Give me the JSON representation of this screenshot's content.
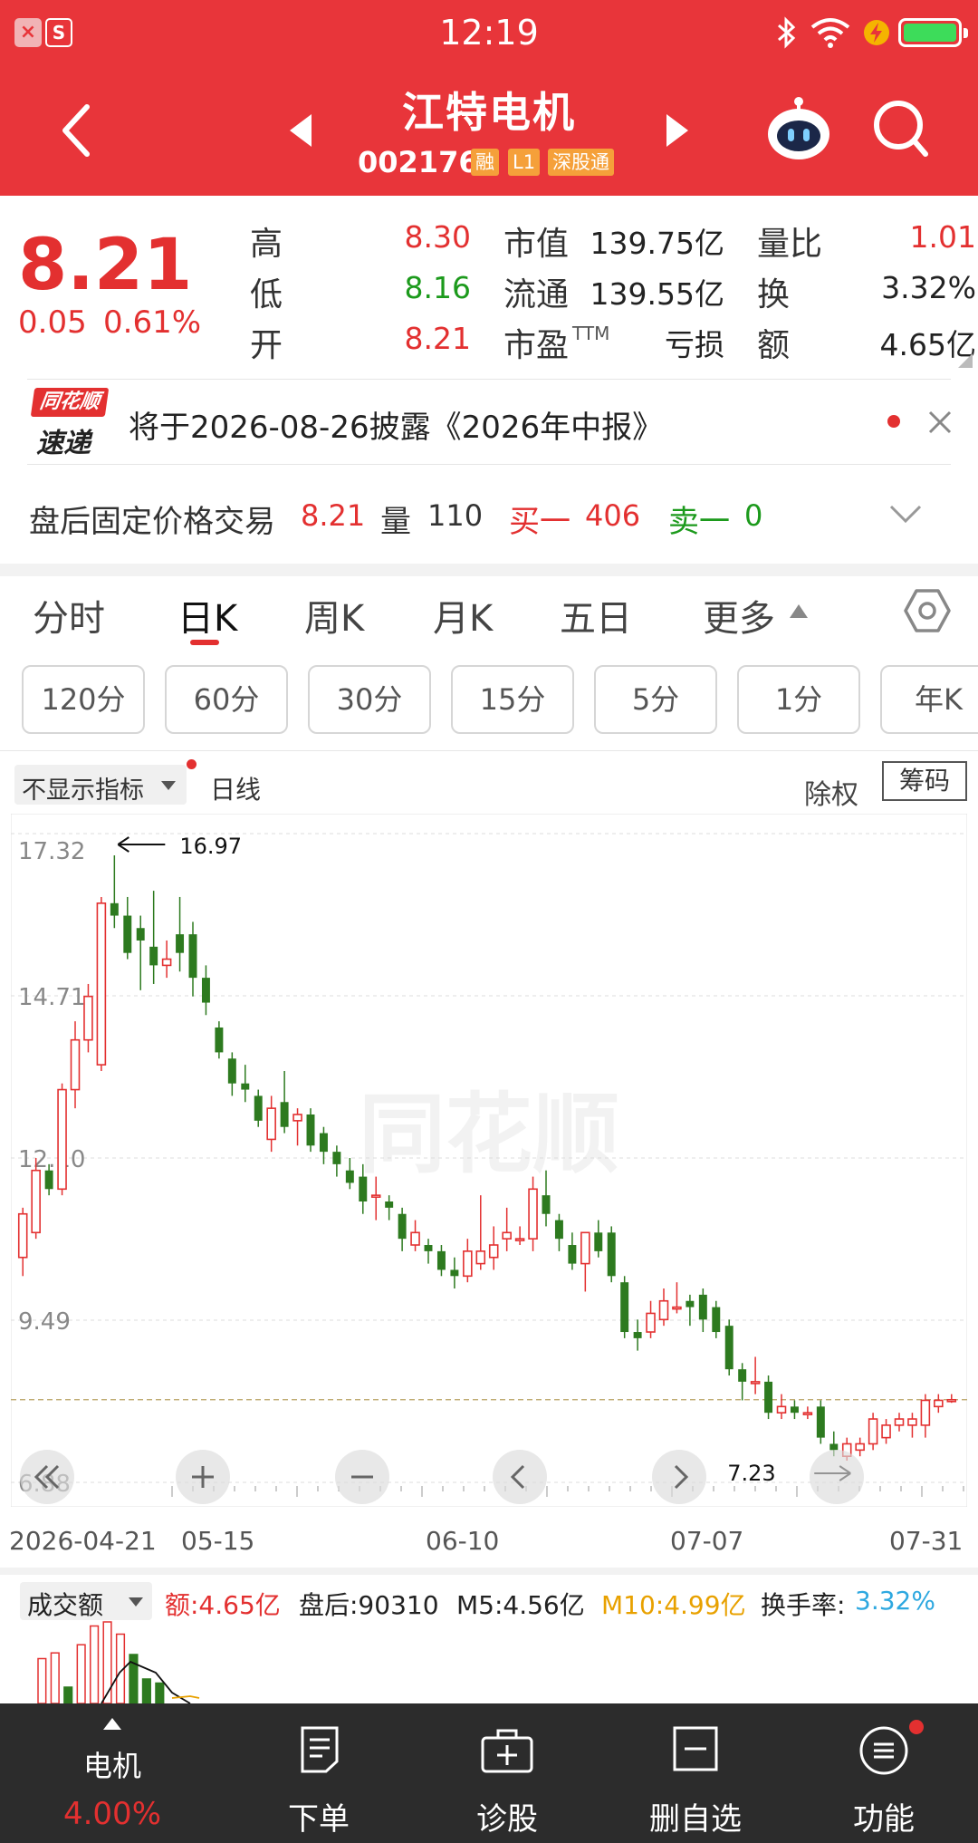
{
  "status_bar": {
    "time": "12:19"
  },
  "header": {
    "title": "江特电机",
    "code": "002176",
    "tags": [
      "融",
      "L1",
      "深股通"
    ]
  },
  "quote": {
    "price": "8.21",
    "change": "0.05",
    "change_pct": "0.61%",
    "fields": {
      "high_label": "高",
      "high": "8.30",
      "low_label": "低",
      "low": "8.16",
      "open_label": "开",
      "open": "8.21",
      "mcap_label": "市值",
      "mcap": "139.75亿",
      "float_label": "流通",
      "float": "139.55亿",
      "pe_label": "市盈",
      "pe_sup": "TTM",
      "pe": "亏损",
      "vr_label": "量比",
      "vr": "1.01",
      "turnover_label": "换",
      "turnover": "3.32%",
      "amount_label": "额",
      "amount": "4.65亿"
    }
  },
  "news": {
    "logo_top": "同花顺",
    "logo_bottom": "速递",
    "text": "将于2026-08-26披露《2026年中报》"
  },
  "after_hours": {
    "label": "盘后固定价格交易",
    "price": "8.21",
    "vol_label": "量",
    "vol": "110",
    "buy_label": "买一",
    "buy": "406",
    "sell_label": "卖一",
    "sell": "0"
  },
  "tabs": [
    "分时",
    "日K",
    "周K",
    "月K",
    "五日",
    "更多"
  ],
  "active_tab": "日K",
  "intervals": [
    "120分",
    "60分",
    "30分",
    "15分",
    "5分",
    "1分",
    "年K"
  ],
  "chart_header": {
    "indicator": "不显示指标",
    "line_type": "日线",
    "adjust": "除权",
    "chips": "筹码"
  },
  "chart_data": {
    "type": "candlestick",
    "y_ticks": [
      "17.32",
      "14.71",
      "12.10",
      "9.49",
      "6.88"
    ],
    "ylim": [
      6.88,
      17.32
    ],
    "x_ticks": [
      "2026-04-21",
      "05-15",
      "06-10",
      "07-07",
      "07-31"
    ],
    "high_annotation": "16.97",
    "low_annotation": "7.23",
    "watermark": "同花顺",
    "reference_price": 8.21,
    "candles": [
      {
        "o": 10.5,
        "c": 11.2,
        "h": 11.3,
        "l": 10.2
      },
      {
        "o": 10.9,
        "c": 11.9,
        "h": 12.1,
        "l": 10.8
      },
      {
        "o": 11.9,
        "c": 11.6,
        "h": 12.0,
        "l": 11.5
      },
      {
        "o": 11.6,
        "c": 13.2,
        "h": 13.3,
        "l": 11.5
      },
      {
        "o": 13.2,
        "c": 14.0,
        "h": 14.3,
        "l": 12.9
      },
      {
        "o": 14.0,
        "c": 14.7,
        "h": 14.9,
        "l": 13.8
      },
      {
        "o": 13.6,
        "c": 16.2,
        "h": 16.3,
        "l": 13.5
      },
      {
        "o": 16.2,
        "c": 16.0,
        "h": 16.97,
        "l": 15.8
      },
      {
        "o": 16.0,
        "c": 15.4,
        "h": 16.3,
        "l": 15.3
      },
      {
        "o": 15.8,
        "c": 15.6,
        "h": 16.0,
        "l": 14.8
      },
      {
        "o": 15.5,
        "c": 15.2,
        "h": 16.4,
        "l": 14.9
      },
      {
        "o": 15.2,
        "c": 15.3,
        "h": 15.6,
        "l": 15.0
      },
      {
        "o": 15.7,
        "c": 15.4,
        "h": 16.3,
        "l": 15.1
      },
      {
        "o": 15.7,
        "c": 15.0,
        "h": 15.9,
        "l": 14.7
      },
      {
        "o": 15.0,
        "c": 14.6,
        "h": 15.2,
        "l": 14.4
      },
      {
        "o": 14.2,
        "c": 13.8,
        "h": 14.3,
        "l": 13.7
      },
      {
        "o": 13.7,
        "c": 13.3,
        "h": 13.8,
        "l": 13.1
      },
      {
        "o": 13.3,
        "c": 13.2,
        "h": 13.6,
        "l": 13.0
      },
      {
        "o": 13.1,
        "c": 12.7,
        "h": 13.2,
        "l": 12.6
      },
      {
        "o": 12.4,
        "c": 12.9,
        "h": 13.1,
        "l": 12.2
      },
      {
        "o": 13.0,
        "c": 12.6,
        "h": 13.5,
        "l": 12.5
      },
      {
        "o": 12.7,
        "c": 12.8,
        "h": 12.9,
        "l": 12.3
      },
      {
        "o": 12.8,
        "c": 12.3,
        "h": 12.9,
        "l": 12.2
      },
      {
        "o": 12.5,
        "c": 12.2,
        "h": 12.6,
        "l": 12.0
      },
      {
        "o": 12.2,
        "c": 12.0,
        "h": 12.3,
        "l": 11.8
      },
      {
        "o": 11.9,
        "c": 11.7,
        "h": 12.1,
        "l": 11.6
      },
      {
        "o": 11.8,
        "c": 11.4,
        "h": 12.0,
        "l": 11.2
      },
      {
        "o": 11.5,
        "c": 11.5,
        "h": 11.8,
        "l": 11.1
      },
      {
        "o": 11.4,
        "c": 11.3,
        "h": 11.5,
        "l": 11.1
      },
      {
        "o": 11.2,
        "c": 10.8,
        "h": 11.3,
        "l": 10.6
      },
      {
        "o": 10.7,
        "c": 10.9,
        "h": 11.1,
        "l": 10.6
      },
      {
        "o": 10.7,
        "c": 10.6,
        "h": 10.8,
        "l": 10.4
      },
      {
        "o": 10.6,
        "c": 10.3,
        "h": 10.7,
        "l": 10.2
      },
      {
        "o": 10.3,
        "c": 10.2,
        "h": 10.5,
        "l": 10.0
      },
      {
        "o": 10.2,
        "c": 10.6,
        "h": 10.8,
        "l": 10.1
      },
      {
        "o": 10.4,
        "c": 10.6,
        "h": 11.5,
        "l": 10.3
      },
      {
        "o": 10.5,
        "c": 10.7,
        "h": 11.0,
        "l": 10.3
      },
      {
        "o": 10.8,
        "c": 10.9,
        "h": 11.3,
        "l": 10.6
      },
      {
        "o": 10.8,
        "c": 10.8,
        "h": 11.0,
        "l": 10.7
      },
      {
        "o": 10.8,
        "c": 11.6,
        "h": 11.8,
        "l": 10.6
      },
      {
        "o": 11.5,
        "c": 11.2,
        "h": 11.9,
        "l": 11.0
      },
      {
        "o": 11.1,
        "c": 10.8,
        "h": 11.2,
        "l": 10.6
      },
      {
        "o": 10.7,
        "c": 10.4,
        "h": 10.9,
        "l": 10.3
      },
      {
        "o": 10.4,
        "c": 10.9,
        "h": 10.9,
        "l": 9.95
      },
      {
        "o": 10.9,
        "c": 10.6,
        "h": 11.1,
        "l": 10.5
      },
      {
        "o": 10.9,
        "c": 10.2,
        "h": 11.0,
        "l": 10.1
      },
      {
        "o": 10.1,
        "c": 9.3,
        "h": 10.2,
        "l": 9.2
      },
      {
        "o": 9.3,
        "c": 9.2,
        "h": 9.5,
        "l": 9.0
      },
      {
        "o": 9.3,
        "c": 9.6,
        "h": 9.8,
        "l": 9.2
      },
      {
        "o": 9.5,
        "c": 9.8,
        "h": 10.0,
        "l": 9.4
      },
      {
        "o": 9.7,
        "c": 9.7,
        "h": 10.1,
        "l": 9.6
      },
      {
        "o": 9.8,
        "c": 9.7,
        "h": 9.9,
        "l": 9.4
      },
      {
        "o": 9.9,
        "c": 9.5,
        "h": 10.0,
        "l": 9.3
      },
      {
        "o": 9.7,
        "c": 9.3,
        "h": 9.8,
        "l": 9.2
      },
      {
        "o": 9.4,
        "c": 8.7,
        "h": 9.5,
        "l": 8.6
      },
      {
        "o": 8.7,
        "c": 8.5,
        "h": 8.8,
        "l": 8.2
      },
      {
        "o": 8.5,
        "c": 8.5,
        "h": 8.9,
        "l": 8.3
      },
      {
        "o": 8.5,
        "c": 8.0,
        "h": 8.6,
        "l": 7.9
      },
      {
        "o": 8.0,
        "c": 8.1,
        "h": 8.3,
        "l": 7.9
      },
      {
        "o": 8.1,
        "c": 8.0,
        "h": 8.2,
        "l": 7.9
      },
      {
        "o": 8.0,
        "c": 8.0,
        "h": 8.1,
        "l": 7.9
      },
      {
        "o": 8.1,
        "c": 7.6,
        "h": 8.2,
        "l": 7.5
      },
      {
        "o": 7.5,
        "c": 7.4,
        "h": 7.7,
        "l": 7.3
      },
      {
        "o": 7.3,
        "c": 7.5,
        "h": 7.6,
        "l": 7.23
      },
      {
        "o": 7.4,
        "c": 7.5,
        "h": 7.6,
        "l": 7.3
      },
      {
        "o": 7.5,
        "c": 7.9,
        "h": 8.0,
        "l": 7.4
      },
      {
        "o": 7.6,
        "c": 7.8,
        "h": 7.9,
        "l": 7.5
      },
      {
        "o": 7.8,
        "c": 7.9,
        "h": 8.0,
        "l": 7.7
      },
      {
        "o": 7.8,
        "c": 7.9,
        "h": 8.0,
        "l": 7.6
      },
      {
        "o": 7.8,
        "c": 8.2,
        "h": 8.3,
        "l": 7.6
      },
      {
        "o": 8.1,
        "c": 8.2,
        "h": 8.3,
        "l": 8.0
      },
      {
        "o": 8.2,
        "c": 8.21,
        "h": 8.3,
        "l": 8.16
      }
    ]
  },
  "volume_header": {
    "label": "成交额",
    "amount": "额:4.65亿",
    "after_hours": "盘后:90310",
    "m5": "M5:4.56亿",
    "m10": "M10:4.99亿",
    "turnover_label": "换手率:",
    "turnover": "3.32%"
  },
  "bottom_nav": {
    "stock_name": "电机",
    "stock_pct": "4.00%",
    "items": [
      "下单",
      "诊股",
      "删自选",
      "功能"
    ]
  },
  "colors": {
    "brand": "#e8353a",
    "up": "#e33030",
    "down": "#2d7a1f",
    "nav_bg": "#2c2c2c"
  }
}
